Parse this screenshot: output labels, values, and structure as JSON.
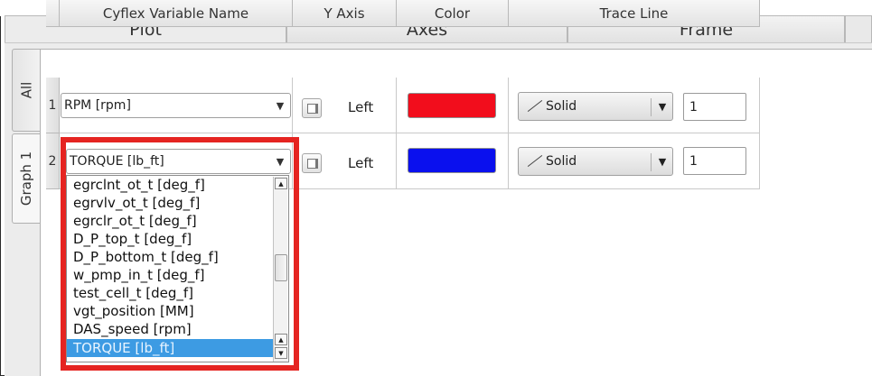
{
  "main_tabs": [
    "Plot",
    "Axes",
    "Frame"
  ],
  "side_tabs": [
    "All",
    "Graph 1"
  ],
  "table": {
    "headers": [
      "Cyflex Variable Name",
      "Y Axis",
      "Color",
      "Trace Line"
    ],
    "rows": [
      {
        "num": "1",
        "variable": "RPM [rpm]",
        "axis": "Left",
        "color": "#f20d1c",
        "line_style": "Solid",
        "line_width": "1"
      },
      {
        "num": "2",
        "variable": "TORQUE [lb_ft]",
        "axis": "Left",
        "color": "#0a10ee",
        "line_style": "Solid",
        "line_width": "1"
      }
    ]
  },
  "dropdown": {
    "items": [
      "egrclnt_ot_t [deg_f]",
      "egrvlv_ot_t [deg_f]",
      "egrclr_ot_t [deg_f]",
      "D_P_top_t [deg_f]",
      "D_P_bottom_t [deg_f]",
      "w_pmp_in_t [deg_f]",
      "test_cell_t [deg_f]",
      "vgt_position [MM]",
      "DAS_speed [rpm]",
      "TORQUE [lb_ft]"
    ],
    "selected_index": 9
  },
  "colors": {
    "highlight_border": "#e52421",
    "selection": "#3d9be3"
  }
}
